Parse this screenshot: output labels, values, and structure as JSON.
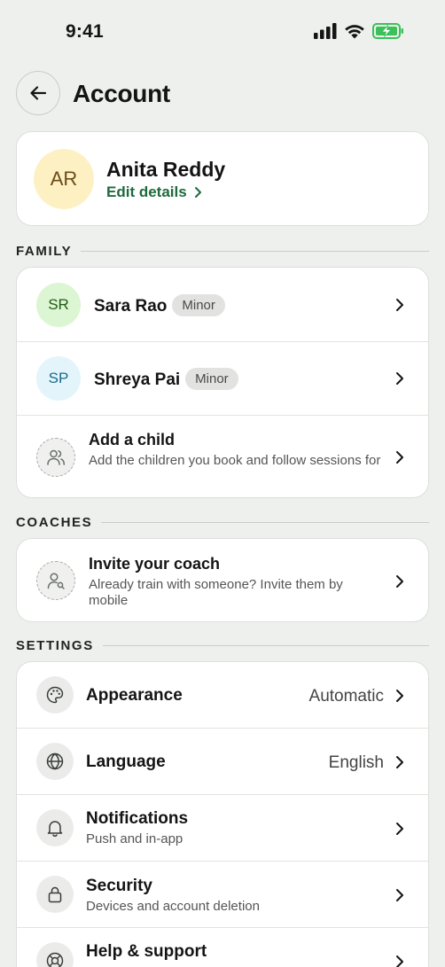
{
  "status": {
    "time": "9:41"
  },
  "header": {
    "title": "Account"
  },
  "profile": {
    "initials": "AR",
    "name": "Anita Reddy",
    "edit_label": "Edit details"
  },
  "family": {
    "label": "FAMILY",
    "members": [
      {
        "initials": "SR",
        "name": "Sara Rao",
        "badge": "Minor",
        "bg": "#dcf5d3",
        "fg": "#1f5b17"
      },
      {
        "initials": "SP",
        "name": "Shreya Pai",
        "badge": "Minor",
        "bg": "#e3f4fb",
        "fg": "#1b6a8a"
      }
    ],
    "add_child": {
      "title": "Add a child",
      "subtitle": "Add the children you book and follow sessions for"
    }
  },
  "coaches": {
    "label": "COACHES",
    "invite": {
      "title": "Invite your coach",
      "subtitle": "Already train with someone? Invite them by mobile"
    }
  },
  "settings": {
    "label": "SETTINGS",
    "items": [
      {
        "title": "Appearance",
        "value": "Automatic"
      },
      {
        "title": "Language",
        "value": "English"
      },
      {
        "title": "Notifications",
        "subtitle": "Push and in-app"
      },
      {
        "title": "Security",
        "subtitle": "Devices and account deletion"
      },
      {
        "title": "Help & support"
      }
    ]
  },
  "colors": {
    "accent": "#1e6a3c",
    "background": "#eef0ed",
    "battery": "#3cc05a"
  }
}
